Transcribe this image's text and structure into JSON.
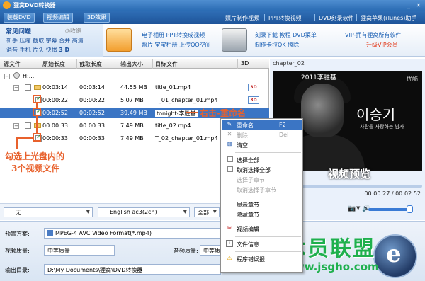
{
  "app": {
    "title": "狸窝DVD转换器",
    "min_icon": "minimize-icon",
    "close_icon": "close-icon"
  },
  "nav": {
    "tabs": [
      "装载DVD",
      "视频编辑",
      "3D效果"
    ],
    "links": [
      "照片制作视频",
      "PPT转换视频",
      "DVD刻录软件",
      "狸窝苹果(iTunes)助手"
    ]
  },
  "ad": {
    "faq_title": "常见问题",
    "faq_collapse": "◎收缩",
    "faq_row1": "新手 压缩 截取 字幕 合并 高清",
    "faq_row2_a": "消音 手机 片头 快播",
    "faq_row2_b": "3 D",
    "promo1_line1": "电子相册 PPT转换成视频",
    "promo1_line2": "照片 宝宝相册 上传QQ空间",
    "promo2_line1": "刻录下载 教程 DVD菜单",
    "promo2_line2": "制作卡拉OK 擦除",
    "vip_line1": "VIP-拥有狸窝所有软件",
    "vip_line2": "升级VIP会员"
  },
  "list": {
    "headers": [
      "源文件",
      "原始长度",
      "截取长度",
      "输出大小",
      "目标文件",
      "3D"
    ],
    "root_label": "H:...",
    "rows": [
      {
        "orig": "00:03:14",
        "cut": "00:03:14",
        "size": "44.55 MB",
        "target": "title_01.mp4",
        "checked": false,
        "kind": "folder"
      },
      {
        "orig": "00:00:22",
        "cut": "00:00:22",
        "size": "5.07 MB",
        "target": "T_01_chapter_01.mp4",
        "checked": true,
        "kind": "item"
      },
      {
        "orig": "00:02:52",
        "cut": "00:02:52",
        "size": "39.49 MB",
        "target": "tonight-李胜基",
        "checked": true,
        "kind": "item",
        "selected": true
      },
      {
        "orig": "00:00:33",
        "cut": "00:00:33",
        "size": "7.49 MB",
        "target": "title_02.mp4",
        "checked": false,
        "kind": "folder"
      },
      {
        "orig": "00:00:33",
        "cut": "00:00:33",
        "size": "7.49 MB",
        "target": "T_02_chapter_01.mp4",
        "checked": true,
        "kind": "item"
      }
    ],
    "badge_3d": "3D"
  },
  "annotations": {
    "rename_hint": "右击-重命名",
    "select_hint_line1": "勾选上光盘内的",
    "select_hint_line2": "3个视频文件"
  },
  "controls": {
    "subtitle_value": "无",
    "audio_value": "English ac3(2ch)",
    "all_label": "全部"
  },
  "preview": {
    "title": "chapter_02",
    "overlay_year": "2011李胜基",
    "overlay_korean": "이승기",
    "overlay_sub": "사람을 사랑하는 남자",
    "overlay_brand": "优酷",
    "label": "视频预览",
    "time": "00:00:27 / 00:02:52",
    "progress": 0.16,
    "volume": 0.9
  },
  "bottom": {
    "preset_label": "预置方案:",
    "preset_value": "MPEG-4 AVC Video Format(*.mp4)",
    "vquality_label": "视频质量:",
    "vquality_value": "中等质量",
    "aquality_label": "音频质量:",
    "aquality_value": "中等质量",
    "outdir_label": "输出目录:",
    "outdir_value": "D:\\My Documents\\狸窝\\DVD转换器"
  },
  "context_menu": {
    "items": [
      {
        "label": "重命名",
        "shortcut": "F2",
        "icon": "rename-icon",
        "state": "highlight"
      },
      {
        "label": "删除",
        "shortcut": "Del",
        "icon": "delete-icon",
        "state": "disabled"
      },
      {
        "label": "清空",
        "shortcut": "",
        "icon": "clear-icon",
        "state": "normal"
      },
      {
        "label": "选择全部",
        "shortcut": "",
        "icon": "checkbox-icon",
        "state": "normal"
      },
      {
        "label": "取消选择全部",
        "shortcut": "",
        "icon": "checkbox-icon",
        "state": "normal"
      },
      {
        "label": "选择子章节",
        "shortcut": "",
        "icon": "",
        "state": "disabled"
      },
      {
        "label": "取消选择子章节",
        "shortcut": "",
        "icon": "",
        "state": "disabled"
      },
      {
        "label": "显示章节",
        "shortcut": "",
        "icon": "",
        "state": "normal"
      },
      {
        "label": "隐藏章节",
        "shortcut": "",
        "icon": "",
        "state": "normal"
      },
      {
        "label": "视频编辑",
        "shortcut": "",
        "icon": "scissors-icon",
        "state": "normal"
      },
      {
        "label": "文件信息",
        "shortcut": "",
        "icon": "file-info-icon",
        "state": "normal"
      },
      {
        "label": "程序错误报",
        "shortcut": "",
        "icon": "warning-icon",
        "state": "normal"
      }
    ]
  },
  "watermark": {
    "text": "技术员联盟",
    "url": "www.jsgho.com"
  },
  "colors": {
    "title_blue": "#2b6cb4",
    "selection": "#3b75c4",
    "annotation": "#e8612c",
    "watermark": "#1fb04d"
  }
}
